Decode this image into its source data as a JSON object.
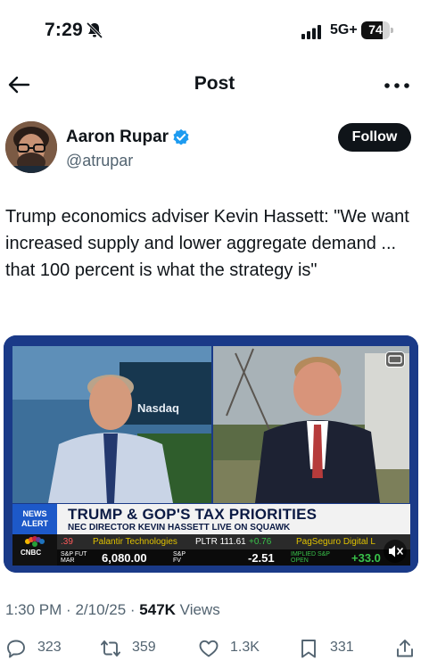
{
  "status_bar": {
    "time": "7:29",
    "network": "5G+",
    "battery": "74",
    "battery_level": 0.74
  },
  "nav": {
    "title": "Post"
  },
  "author": {
    "name": "Aaron Rupar",
    "handle": "@atrupar",
    "follow_label": "Follow"
  },
  "post": {
    "text": "Trump economics adviser Kevin Hassett: \"We want increased supply and lower aggregate demand ... that 100 percent is what the strategy is\"",
    "time": "1:30 PM",
    "date": "2/10/25",
    "views_count": "547K",
    "views_label": "Views"
  },
  "video": {
    "news_alert": "NEWS ALERT",
    "headline": "TRUMP & GOP'S TAX PRIORITIES",
    "subhead": "NEC DIRECTOR KEVIN HASSETT LIVE ON SQUAWK",
    "network_logo": "CNBC",
    "nasdaq_sign": "Nasdaq",
    "ticker_top": [
      {
        "text": ".39"
      },
      {
        "text": "Palantir Technologies"
      },
      {
        "text": "PLTR 111.61"
      },
      {
        "text": "+0.76"
      },
      {
        "text": "PagSeguro Digital L"
      }
    ],
    "ticker_bottom": [
      {
        "text": "S&P FUT MAR"
      },
      {
        "text": "6,080.00"
      },
      {
        "text": "S&P FV"
      },
      {
        "text": "-2.51"
      },
      {
        "text": "IMPLIED S&P OPEN"
      },
      {
        "text": "+33.0"
      }
    ]
  },
  "actions": {
    "replies": "323",
    "reposts": "359",
    "likes": "1.3K",
    "bookmarks": "331"
  },
  "colors": {
    "text": "#0f1419",
    "muted": "#536471",
    "verified": "#1d9bf0",
    "video_frame": "#1a3a88"
  }
}
